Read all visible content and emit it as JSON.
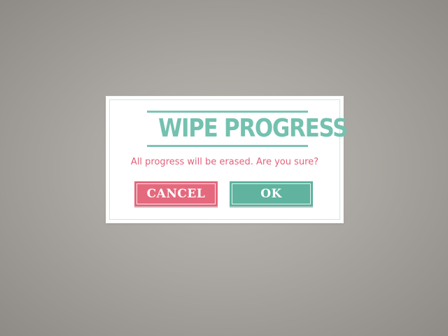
{
  "dialog": {
    "title": "WIPE PROGRESS",
    "message": "All progress will be erased. Are you sure?",
    "cancel_label": "CANCEL",
    "ok_label": "OK"
  },
  "colors": {
    "title_teal": "#74c1b0",
    "message_pink": "#e0627b",
    "cancel_button": "#e4697d",
    "ok_button": "#5fb39f",
    "background_gray": "#aaa6a1"
  }
}
